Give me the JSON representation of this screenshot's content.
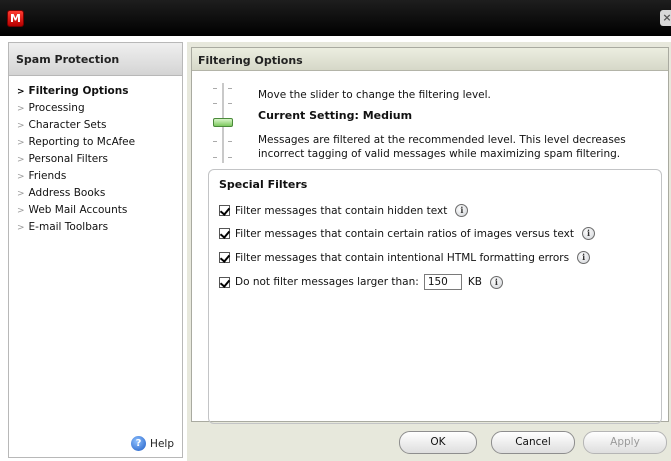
{
  "window": {
    "logo_letter": "M",
    "close_glyph": "×"
  },
  "sidebar": {
    "title": "Spam Protection",
    "items": [
      {
        "label": "Filtering Options",
        "active": true
      },
      {
        "label": "Processing"
      },
      {
        "label": "Character Sets"
      },
      {
        "label": "Reporting to McAfee"
      },
      {
        "label": "Personal Filters"
      },
      {
        "label": "Friends"
      },
      {
        "label": "Address Books"
      },
      {
        "label": "Web Mail Accounts"
      },
      {
        "label": "E-mail Toolbars"
      }
    ],
    "help_label": "Help"
  },
  "main": {
    "title": "Filtering Options",
    "slider_instruction": "Move the slider to change the filtering level.",
    "current_setting": "Current Setting: Medium",
    "description": "Messages are filtered at the recommended level. This level decreases incorrect tagging of valid messages while maximizing spam filtering.",
    "special_filters": {
      "title": "Special Filters",
      "filters": [
        {
          "label": "Filter messages that contain hidden text",
          "checked": true
        },
        {
          "label": "Filter messages that contain certain ratios of images versus text",
          "checked": true
        },
        {
          "label": "Filter messages that contain intentional HTML formatting errors",
          "checked": true
        },
        {
          "label": "Do not filter messages larger than:",
          "checked": true,
          "value": "150",
          "unit": "KB"
        }
      ]
    }
  },
  "buttons": {
    "ok": "OK",
    "cancel": "Cancel",
    "apply": "Apply"
  },
  "colors": {
    "title_bar": "#000000",
    "logo": "#d40000",
    "footer_panel": "#e7e8dc"
  }
}
